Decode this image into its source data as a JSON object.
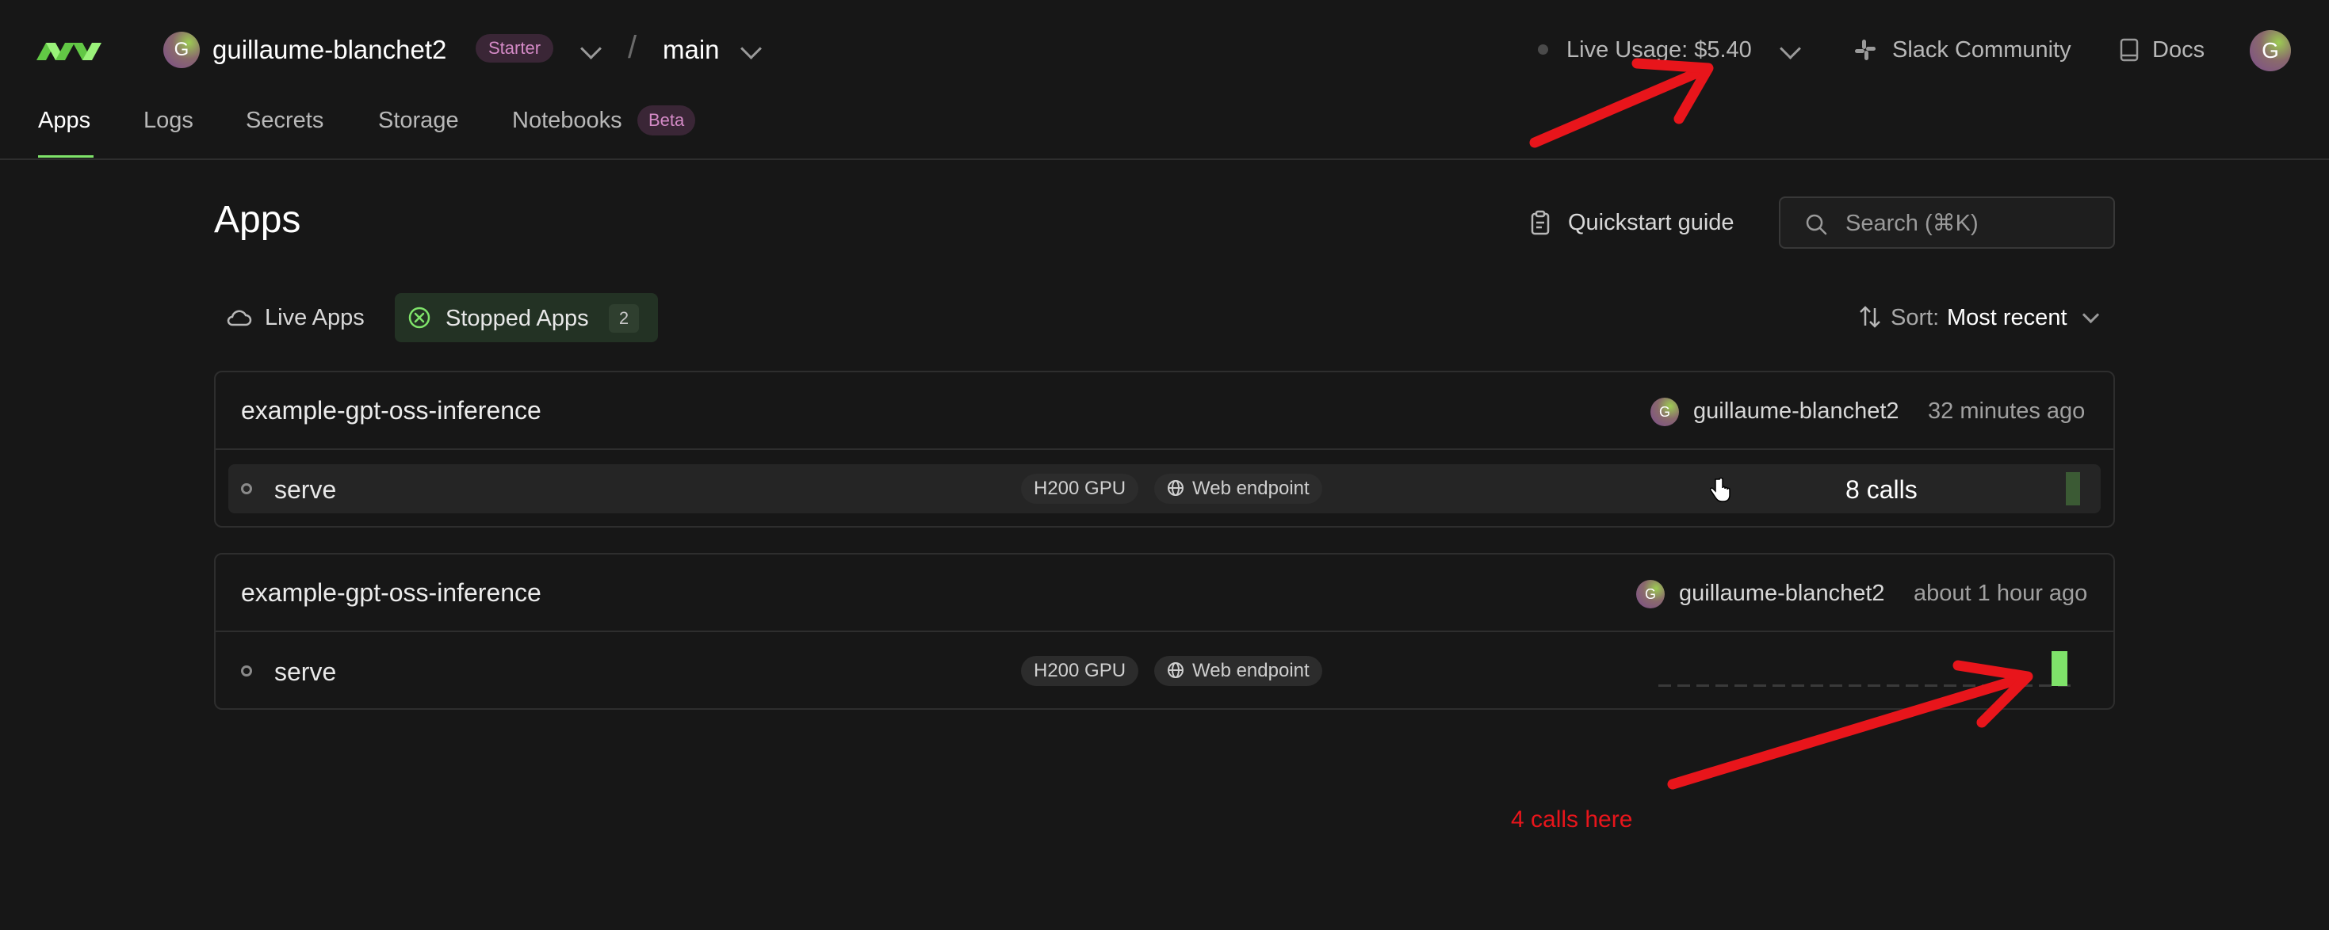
{
  "header": {
    "workspace_avatar_letter": "G",
    "workspace_name": "guillaume-blanchet2",
    "plan_badge": "Starter",
    "separator": "/",
    "environment": "main",
    "live_usage": "Live Usage: $5.40",
    "slack_label": "Slack Community",
    "docs_label": "Docs",
    "user_avatar_letter": "G"
  },
  "tabs": [
    {
      "label": "Apps",
      "active": true
    },
    {
      "label": "Logs"
    },
    {
      "label": "Secrets"
    },
    {
      "label": "Storage"
    },
    {
      "label": "Notebooks",
      "badge": "Beta"
    }
  ],
  "page": {
    "title": "Apps",
    "quickstart_label": "Quickstart guide",
    "search_placeholder": "Search (⌘K)"
  },
  "filters": {
    "live_label": "Live Apps",
    "stopped_label": "Stopped Apps",
    "stopped_count": "2",
    "sort_prefix": "Sort:",
    "sort_value": "Most recent"
  },
  "apps": [
    {
      "name": "example-gpt-oss-inference",
      "owner": "guillaume-blanchet2",
      "owner_avatar_letter": "G",
      "time": "32 minutes ago",
      "function": {
        "name": "serve",
        "gpu": "H200 GPU",
        "endpoint": "Web endpoint",
        "calls_label": "8 calls"
      }
    },
    {
      "name": "example-gpt-oss-inference",
      "owner": "guillaume-blanchet2",
      "owner_avatar_letter": "G",
      "time": "about 1 hour ago",
      "function": {
        "name": "serve",
        "gpu": "H200 GPU",
        "endpoint": "Web endpoint"
      }
    }
  ],
  "annotation": {
    "text": "4 calls here",
    "color": "#e8151b"
  },
  "colors": {
    "accent_green": "#7fe36a",
    "badge_pink": "#d48ac6",
    "background": "#171717"
  }
}
